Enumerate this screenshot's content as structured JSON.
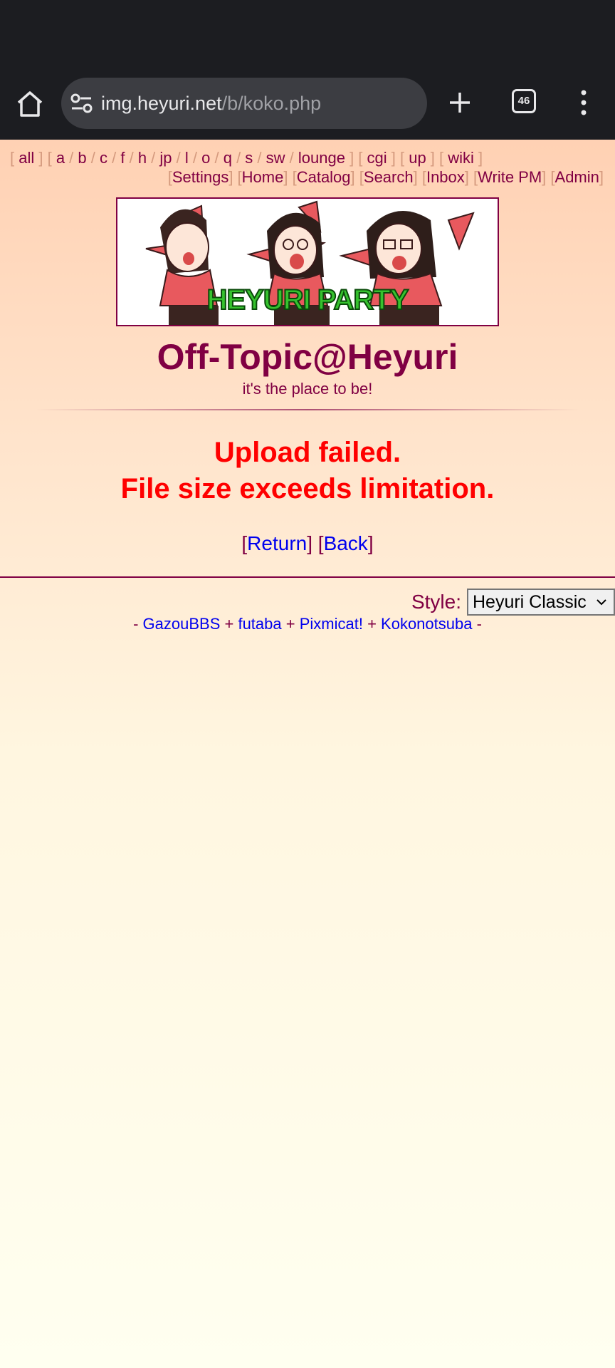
{
  "browser": {
    "url_host": "img.heyuri.net",
    "url_path": "/b/koko.php",
    "tab_count": "46"
  },
  "boardnav": {
    "links": [
      "all",
      "a",
      "b",
      "c",
      "f",
      "h",
      "jp",
      "l",
      "o",
      "q",
      "s",
      "sw",
      "lounge",
      "cgi",
      "up",
      "wiki"
    ]
  },
  "toplinks": [
    "Settings",
    "Home",
    "Catalog",
    "Search",
    "Inbox",
    "Write PM",
    "Admin"
  ],
  "banner": {
    "text": "HEYURI PARTY"
  },
  "board": {
    "title": "Off-Topic@Heyuri",
    "subtitle": "it's the place to be!"
  },
  "error": {
    "line1": "Upload failed.",
    "line2": "File size exceeds limitation."
  },
  "return_links": {
    "return": "Return",
    "back": "Back"
  },
  "style_selector": {
    "label": "Style:",
    "selected": "Heyuri Classic"
  },
  "footer": {
    "links": [
      "GazouBBS",
      "futaba",
      "Pixmicat!",
      "Kokonotsuba"
    ]
  },
  "colors": {
    "text": "#800043",
    "link": "#0000ee",
    "error": "#ff0000",
    "bracket": "#d59a7e",
    "chrome": "#1c1d21"
  }
}
